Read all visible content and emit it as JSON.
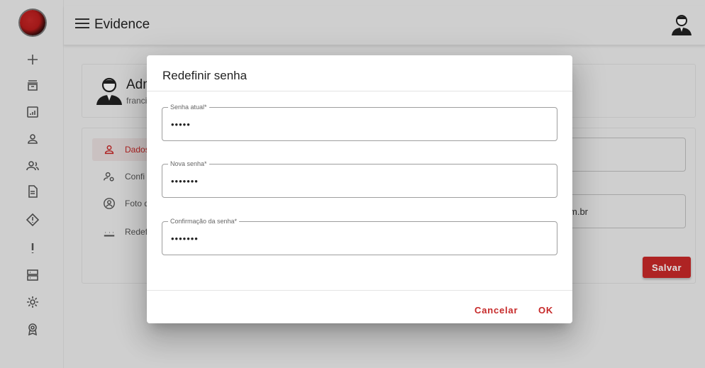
{
  "app": {
    "title": "Evidence"
  },
  "sidebar": {
    "icons": [
      "plus-icon",
      "archive-icon",
      "chart-icon",
      "user-icon",
      "users-icon",
      "document-icon",
      "diamond-alert-icon",
      "exclamation-icon",
      "server-icon",
      "gear-icon",
      "badge-icon"
    ]
  },
  "profile": {
    "name": "Adm",
    "email": "franci"
  },
  "profile_menu": {
    "items": [
      {
        "label": "Dados",
        "icon": "user-icon",
        "active": true
      },
      {
        "label": "Confi",
        "icon": "user-gear-icon",
        "active": false
      },
      {
        "label": "Foto d",
        "icon": "photo-user-icon",
        "active": false
      },
      {
        "label": "Redef",
        "icon": "password-icon",
        "active": false
      }
    ]
  },
  "background_fields": {
    "email_value": "m.br"
  },
  "save_button": {
    "label": "Salvar"
  },
  "dialog": {
    "title": "Redefinir senha",
    "fields": [
      {
        "label": "Senha atual*",
        "value": "•••••"
      },
      {
        "label": "Nova senha*",
        "value": "•••••••"
      },
      {
        "label": "Confirmação da senha*",
        "value": "•••••••"
      }
    ],
    "cancel_label": "Cancelar",
    "ok_label": "OK"
  },
  "colors": {
    "accent": "#c62828",
    "background": "#ececec"
  }
}
